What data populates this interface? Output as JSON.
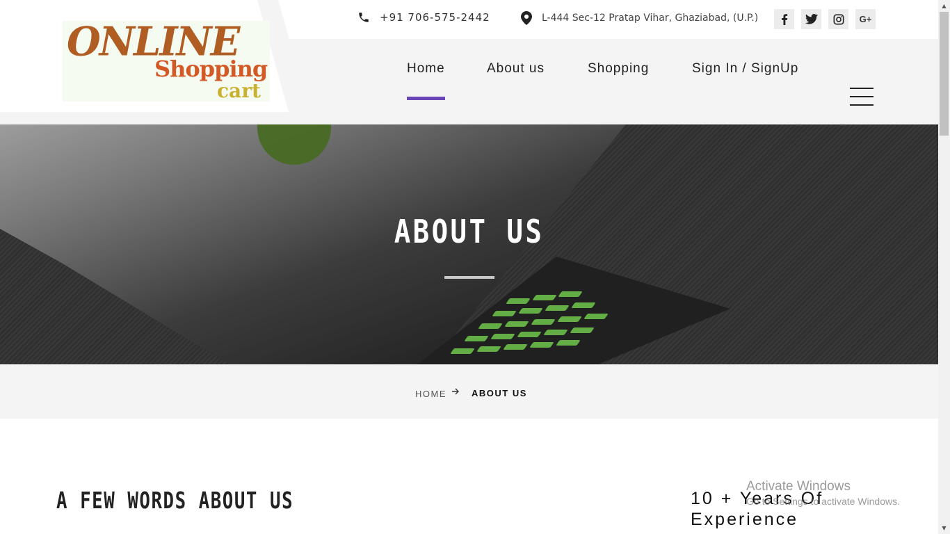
{
  "brand": {
    "line1": "ONLINE",
    "line2": "Shopping",
    "line3": "cart"
  },
  "contact": {
    "phone": "+91 706-575-2442",
    "address": "L-444 Sec-12 Pratap Vihar, Ghaziabad, (U.P.)"
  },
  "social": [
    {
      "icon": "facebook-icon",
      "glyph": "f"
    },
    {
      "icon": "twitter-icon",
      "glyph": "t"
    },
    {
      "icon": "instagram-icon",
      "glyph": "ig"
    },
    {
      "icon": "google-plus-icon",
      "glyph": "G+"
    }
  ],
  "nav": {
    "items": [
      {
        "label": "Home",
        "active": true
      },
      {
        "label": "About us",
        "active": false
      },
      {
        "label": "Shopping",
        "active": false
      },
      {
        "label": "Sign In / SignUp",
        "active": false
      }
    ]
  },
  "hero": {
    "title": "ABOUT US"
  },
  "breadcrumb": {
    "home": "HOME",
    "current": "ABOUT US"
  },
  "content": {
    "section_title": "A FEW WORDS ABOUT US",
    "experience_line1": "10 + Years Of",
    "experience_line2": "Experience"
  },
  "watermark": {
    "title": "Activate Windows",
    "subtitle": "Go to Settings to activate Windows."
  },
  "colors": {
    "accent": "#6a46b8",
    "header_bg": "#f4f4f4"
  }
}
